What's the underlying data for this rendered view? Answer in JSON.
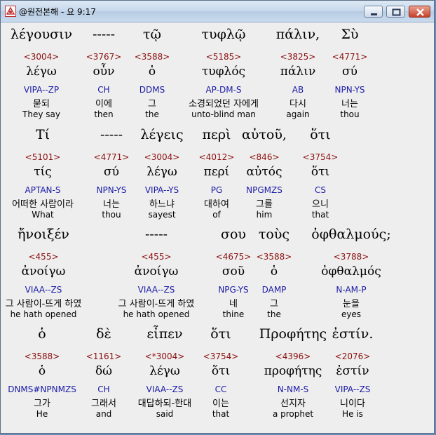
{
  "window": {
    "title": "@원전본해 - 요 9:17"
  },
  "rows": [
    {
      "cols": [
        {
          "greek": "λέγουσιν",
          "num": "<3004>",
          "lex": "λέγω",
          "parse": "VIPA--ZP",
          "kor": "묻되",
          "eng": "They say"
        },
        {
          "greek": "-----",
          "num": "<3767>",
          "lex": "οὖν",
          "parse": "CH",
          "kor": "이에",
          "eng": "then"
        },
        {
          "greek": "τῷ",
          "num": "<3588>",
          "lex": "ὁ",
          "parse": "DDMS",
          "kor": "그",
          "eng": "the"
        },
        {
          "greek": "τυφλῷ",
          "num": "<5185>",
          "lex": "τυφλός",
          "parse": "AP-DM-S",
          "kor": "소경되었던 자에게",
          "eng": "unto-blind man"
        },
        {
          "greek": "πάλιν,",
          "num": "<3825>",
          "lex": "πάλιν",
          "parse": "AB",
          "kor": "다시",
          "eng": "again"
        },
        {
          "greek": "Σὺ",
          "num": "<4771>",
          "lex": "σύ",
          "parse": "NPN-YS",
          "kor": "너는",
          "eng": "thou"
        }
      ]
    },
    {
      "cols": [
        {
          "greek": "Τί",
          "num": "<5101>",
          "lex": "τίς",
          "parse": "APTAN-S",
          "kor": "어떠한 사람이라",
          "eng": "What"
        },
        {
          "greek": "-----",
          "num": "<4771>",
          "lex": "σύ",
          "parse": "NPN-YS",
          "kor": "너는",
          "eng": "thou"
        },
        {
          "greek": "λέγεις",
          "num": "<3004>",
          "lex": "λέγω",
          "parse": "VIPA--YS",
          "kor": "하느냐",
          "eng": "sayest"
        },
        {
          "greek": "περὶ",
          "num": "<4012>",
          "lex": "περί",
          "parse": "PG",
          "kor": "대하여",
          "eng": "of"
        },
        {
          "greek": "αὐτοῦ,",
          "num": "<846>",
          "lex": "αὐτός",
          "parse": "NPGMZS",
          "kor": "그를",
          "eng": "him"
        },
        {
          "greek": "ὅτι",
          "num": "<3754>",
          "lex": "ὅτι",
          "parse": "CS",
          "kor": "으니",
          "eng": "that"
        }
      ]
    },
    {
      "cols": [
        {
          "greek": "ἤνοιξέν",
          "num": "<455>",
          "lex": "ἀνοίγω",
          "parse": "VIAA--ZS",
          "kor": "그 사람이-뜨게 하였",
          "eng": "he hath opened"
        },
        {
          "greek": "-----",
          "num": "<455>",
          "lex": "ἀνοίγω",
          "parse": "VIAA--ZS",
          "kor": "그 사람이-뜨게 하였",
          "eng": "he hath opened"
        },
        {
          "greek": "σου",
          "num": "<4675>",
          "lex": "σοῦ",
          "parse": "NPG-YS",
          "kor": "네",
          "eng": "thine"
        },
        {
          "greek": "τοὺς",
          "num": "<3588>",
          "lex": "ὁ",
          "parse": "DAMP",
          "kor": "그",
          "eng": "the"
        },
        {
          "greek": "ὀφθαλμούς;",
          "num": "<3788>",
          "lex": "ὀφθαλμός",
          "parse": "N-AM-P",
          "kor": "눈을",
          "eng": "eyes"
        }
      ]
    },
    {
      "cols": [
        {
          "greek": "ὁ",
          "num": "<3588>",
          "lex": "ὁ",
          "parse": "DNMS#NPNMZS",
          "kor": "그가",
          "eng": "He"
        },
        {
          "greek": "δὲ",
          "num": "<1161>",
          "lex": "δώ",
          "parse": "CH",
          "kor": "그래서",
          "eng": "and"
        },
        {
          "greek": "εἶπεν",
          "num": "<*3004>",
          "lex": "λέγω",
          "parse": "VIAA--ZS",
          "kor": "대답하되-한대",
          "eng": "said"
        },
        {
          "greek": "ὅτι",
          "num": "<3754>",
          "lex": "ὅτι",
          "parse": "CC",
          "kor": "이는",
          "eng": "that"
        },
        {
          "greek": "Προφήτης",
          "num": "<4396>",
          "lex": "προφήτης",
          "parse": "N-NM-S",
          "kor": "선지자",
          "eng": "a prophet"
        },
        {
          "greek": "ἐστίν.",
          "num": "<2076>",
          "lex": "ἐστίν",
          "parse": "VIPA--ZS",
          "kor": "니이다",
          "eng": "He is"
        }
      ]
    }
  ]
}
